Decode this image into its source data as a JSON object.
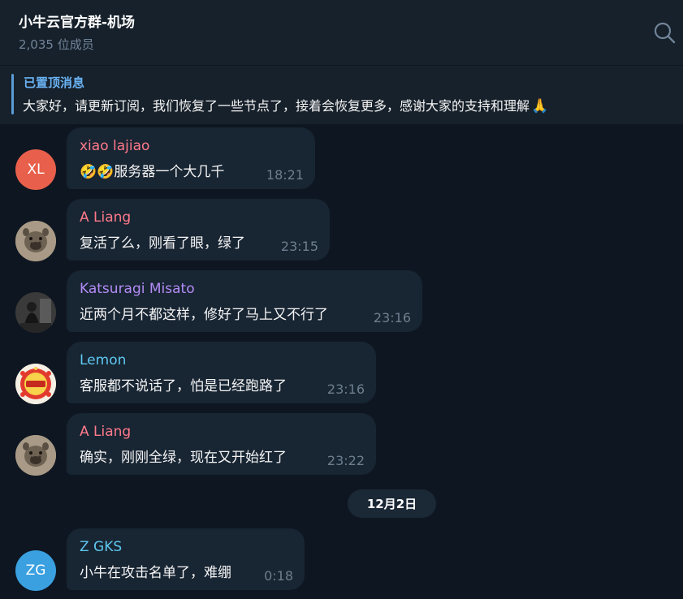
{
  "header": {
    "title": "小牛云官方群-机场",
    "members": "2,035 位成员"
  },
  "pinned": {
    "label": "已置顶消息",
    "text": "大家好，请更新订阅，我们恢复了一些节点了，接着会恢复更多，感谢大家的支持和理解",
    "emoji": "🙏"
  },
  "messages": [
    {
      "sender": "xiao lajiao",
      "sender_color": "#ff7a8a",
      "avatar_initials": "XL",
      "avatar_color": "#e8604b",
      "text": "🤣🤣服务器一个大几千",
      "time": "18:21"
    },
    {
      "sender": "A Liang",
      "sender_color": "#ff7a8a",
      "avatar_icon": "hyena-photo-avatar",
      "text": "复活了么，刚看了眼，绿了",
      "time": "23:15"
    },
    {
      "sender": "Katsuragi Misato",
      "sender_color": "#b48cf5",
      "avatar_icon": "person-photo-avatar",
      "text": "近两个月不都这样，修好了马上又不行了",
      "time": "23:16"
    },
    {
      "sender": "Lemon",
      "sender_color": "#5ec8f0",
      "avatar_icon": "new-year-sticker-avatar",
      "text": "客服都不说话了，怕是已经跑路了",
      "time": "23:16"
    },
    {
      "sender": "A Liang",
      "sender_color": "#ff7a8a",
      "avatar_icon": "hyena-photo-avatar",
      "text": "确实，刚刚全绿，现在又开始红了",
      "time": "23:22"
    },
    {
      "sender": "Z GKS",
      "sender_color": "#5ec8f0",
      "avatar_initials": "ZG",
      "avatar_color": "#3aa0e0",
      "text": "小牛在攻击名单了，难绷",
      "time": "0:18"
    }
  ],
  "date_separator": "12月2日"
}
